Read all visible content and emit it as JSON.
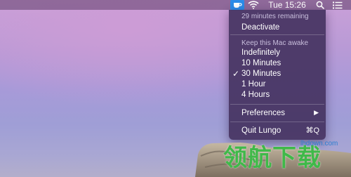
{
  "menubar": {
    "clock": "Tue 15:26",
    "icons": [
      "lungo-cup-icon",
      "wifi-icon",
      "search-icon",
      "list-icon"
    ]
  },
  "menu": {
    "status": "29 minutes remaining",
    "deactivate": "Deactivate",
    "section_header": "Keep this Mac awake",
    "durations": [
      "Indefinitely",
      "10 Minutes",
      "30 Minutes",
      "1 Hour",
      "4 Hours"
    ],
    "selected_duration": "30 Minutes",
    "check_mark": "✓",
    "preferences": "Preferences",
    "submenu_arrow": "▶",
    "quit": "Quit Lungo",
    "quit_shortcut": "⌘Q"
  },
  "watermark": {
    "site": "lhdown.com",
    "chinese": "领航下载"
  },
  "colors": {
    "menu_bg": "#46346a",
    "lungo_icon": "#2b8be8",
    "watermark_green": "#3fb949",
    "watermark_blue": "#2e7fd0"
  }
}
